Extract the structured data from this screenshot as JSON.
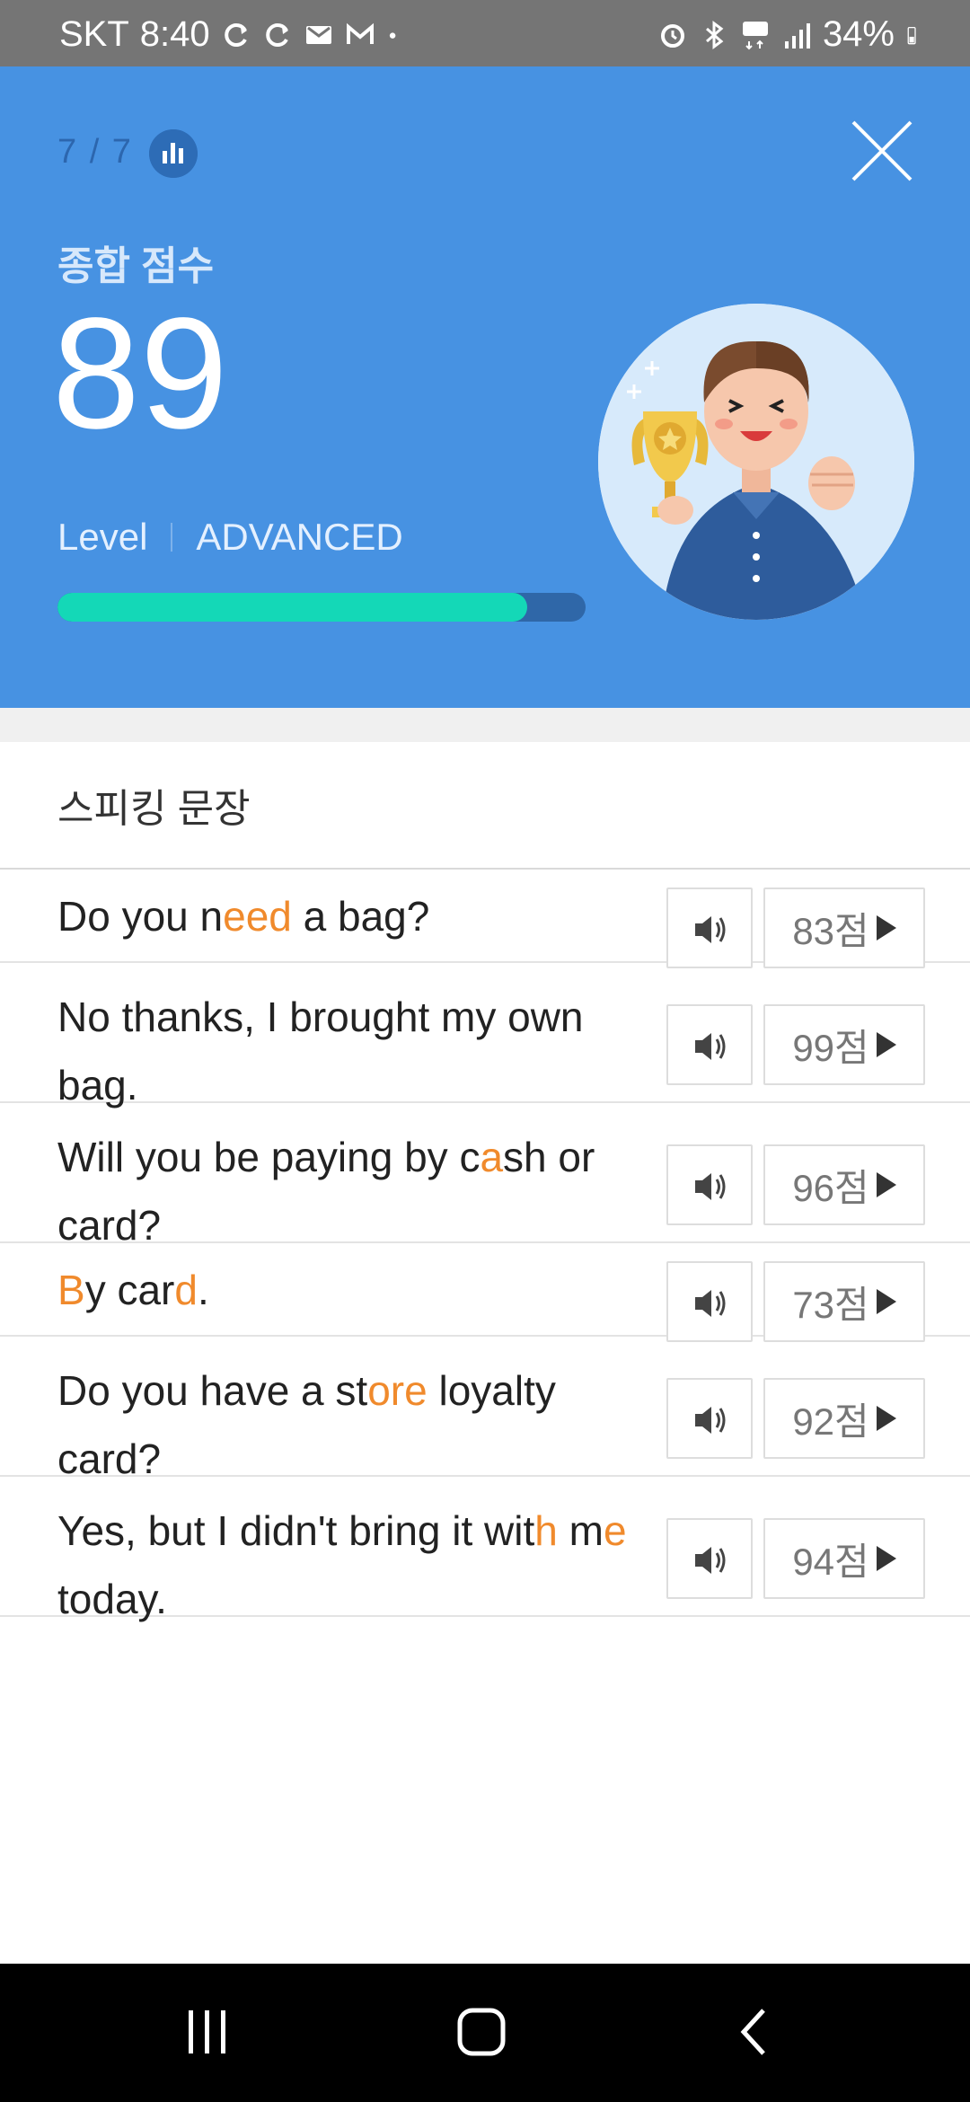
{
  "status_bar": {
    "carrier": "SKT",
    "time": "8:40",
    "battery": "34%",
    "icons_left": [
      "sync-icon",
      "sync-icon",
      "mail-icon",
      "gmail-icon",
      "dot-icon"
    ],
    "icons_right": [
      "alarm-icon",
      "bluetooth-icon",
      "5g-icon",
      "signal-icon",
      "battery-icon"
    ]
  },
  "header": {
    "progress": "7 / 7",
    "score_label": "종합 점수",
    "score": "89",
    "level_label": "Level",
    "level_value": "ADVANCED",
    "level_progress": 0.89,
    "colors": {
      "background": "#4792E2",
      "bar_fill": "#14D8B7",
      "bar_track": "#2F67A8"
    }
  },
  "section": {
    "title": "스피킹 문장"
  },
  "sentences": [
    {
      "parts": [
        [
          "Do you n",
          false
        ],
        [
          "eed",
          true
        ],
        [
          " a bag?",
          false
        ]
      ],
      "score": "83점"
    },
    {
      "parts": [
        [
          "No thanks, I brought my own bag.",
          false
        ]
      ],
      "score": "99점"
    },
    {
      "parts": [
        [
          "Will you be paying by c",
          false
        ],
        [
          "a",
          true
        ],
        [
          "sh or card?",
          false
        ]
      ],
      "score": "96점"
    },
    {
      "parts": [
        [
          "B",
          true
        ],
        [
          "y car",
          false
        ],
        [
          "d",
          true
        ],
        [
          ".",
          false
        ]
      ],
      "score": "73점"
    },
    {
      "parts": [
        [
          "Do you have a st",
          false
        ],
        [
          "ore",
          true
        ],
        [
          " loyalty card?",
          false
        ]
      ],
      "score": "92점"
    },
    {
      "parts": [
        [
          "Yes, but I didn't bring it wit",
          false
        ],
        [
          "h",
          true
        ],
        [
          " m",
          false
        ],
        [
          "e",
          true
        ],
        [
          " today.",
          false
        ]
      ],
      "score": "94점"
    }
  ],
  "highlight_color": "#F08A2C"
}
